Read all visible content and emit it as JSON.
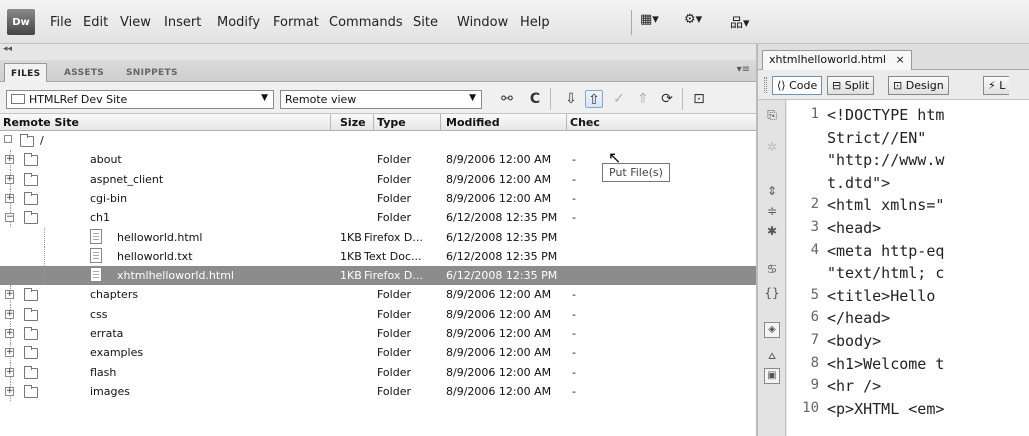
{
  "app": {
    "logo": "Dw"
  },
  "menu": {
    "items": [
      "File",
      "Edit",
      "View",
      "Insert",
      "Modify",
      "Format",
      "Commands",
      "Site",
      "Window",
      "Help"
    ]
  },
  "menu_buttons": [
    {
      "icon": "layout-icon",
      "glyph": "▦▾"
    },
    {
      "icon": "gear-icon",
      "glyph": "⚙▾"
    },
    {
      "icon": "site-map-icon",
      "glyph": "品▾"
    }
  ],
  "panel": {
    "collapse_glyph": "◂◂",
    "tabs": [
      "FILES",
      "ASSETS",
      "SNIPPETS"
    ],
    "active_tab": "FILES",
    "menu_glyph": "▾≡",
    "site_select": "HTMLRef Dev Site",
    "view_select": "Remote view",
    "toolbar_icons": [
      {
        "name": "connect-icon",
        "glyph": "⚯"
      },
      {
        "name": "refresh-icon",
        "glyph": "C"
      },
      {
        "name": "get-file-icon",
        "glyph": "⇩"
      },
      {
        "name": "put-file-icon",
        "glyph": "⇧"
      },
      {
        "name": "check-out-icon",
        "glyph": "✓"
      },
      {
        "name": "check-in-icon",
        "glyph": "⇑"
      },
      {
        "name": "synchronize-icon",
        "glyph": "⟳"
      },
      {
        "name": "expand-icon",
        "glyph": "⊡"
      }
    ],
    "tooltip": "Put File(s)",
    "columns": {
      "name": "Remote Site",
      "size": "Size",
      "type": "Type",
      "modified": "Modified",
      "checked": "Chec"
    },
    "root": "/",
    "files": [
      {
        "name": "about",
        "size": "",
        "type": "Folder",
        "modified": "8/9/2006 12:00 AM",
        "checked": "-",
        "kind": "folder",
        "level": 1,
        "expander": "+"
      },
      {
        "name": "aspnet_client",
        "size": "",
        "type": "Folder",
        "modified": "8/9/2006 12:00 AM",
        "checked": "-",
        "kind": "folder",
        "level": 1,
        "expander": "+"
      },
      {
        "name": "cgi-bin",
        "size": "",
        "type": "Folder",
        "modified": "8/9/2006 12:00 AM",
        "checked": "-",
        "kind": "folder",
        "level": 1,
        "expander": "+"
      },
      {
        "name": "ch1",
        "size": "",
        "type": "Folder",
        "modified": "6/12/2008 12:35 PM",
        "checked": "-",
        "kind": "folder",
        "level": 1,
        "expander": "−"
      },
      {
        "name": "helloworld.html",
        "size": "1KB",
        "type": "Firefox D...",
        "modified": "6/12/2008 12:35 PM",
        "checked": "",
        "kind": "html",
        "level": 2
      },
      {
        "name": "helloworld.txt",
        "size": "1KB",
        "type": "Text Doc...",
        "modified": "6/12/2008 12:35 PM",
        "checked": "",
        "kind": "text",
        "level": 2
      },
      {
        "name": "xhtmlhelloworld.html",
        "size": "1KB",
        "type": "Firefox D...",
        "modified": "6/12/2008 12:35 PM",
        "checked": "",
        "kind": "html",
        "level": 2,
        "selected": true
      },
      {
        "name": "chapters",
        "size": "",
        "type": "Folder",
        "modified": "8/9/2006 12:00 AM",
        "checked": "-",
        "kind": "folder",
        "level": 1,
        "expander": "+"
      },
      {
        "name": "css",
        "size": "",
        "type": "Folder",
        "modified": "8/9/2006 12:00 AM",
        "checked": "-",
        "kind": "folder",
        "level": 1,
        "expander": "+"
      },
      {
        "name": "errata",
        "size": "",
        "type": "Folder",
        "modified": "8/9/2006 12:00 AM",
        "checked": "-",
        "kind": "folder",
        "level": 1,
        "expander": "+"
      },
      {
        "name": "examples",
        "size": "",
        "type": "Folder",
        "modified": "8/9/2006 12:00 AM",
        "checked": "-",
        "kind": "folder",
        "level": 1,
        "expander": "+"
      },
      {
        "name": "flash",
        "size": "",
        "type": "Folder",
        "modified": "8/9/2006 12:00 AM",
        "checked": "-",
        "kind": "folder",
        "level": 1,
        "expander": "+"
      },
      {
        "name": "images",
        "size": "",
        "type": "Folder",
        "modified": "8/9/2006 12:00 AM",
        "checked": "-",
        "kind": "folder",
        "level": 1,
        "expander": "+"
      }
    ]
  },
  "document": {
    "tab_title": "xhtmlhelloworld.html",
    "close_glyph": "×",
    "view_buttons": [
      "Code",
      "Split",
      "Design"
    ],
    "active_view": "Code",
    "truncated_button": "L",
    "gutter_icons": [
      "open-documents-icon",
      "collapse-icon",
      "expand-all-icon",
      "select-parent-icon",
      "balance-braces-icon",
      "line-numbers-icon",
      "highlight-invalid-icon",
      "syntax-coloring-icon",
      "apply-comment-icon",
      "format-source-icon"
    ],
    "lines": [
      {
        "num": "1",
        "text": "<!DOCTYPE htm"
      },
      {
        "num": "",
        "text": "Strict//EN\""
      },
      {
        "num": "",
        "text": "\"http://www.w"
      },
      {
        "num": "",
        "text": "t.dtd\">"
      },
      {
        "num": "2",
        "text": "<html xmlns=\""
      },
      {
        "num": "3",
        "text": "<head>"
      },
      {
        "num": "4",
        "text": "<meta http-eq"
      },
      {
        "num": "",
        "text": "\"text/html; c"
      },
      {
        "num": "5",
        "text": "<title>Hello "
      },
      {
        "num": "6",
        "text": "</head>"
      },
      {
        "num": "7",
        "text": "<body>"
      },
      {
        "num": "8",
        "text": "<h1>Welcome t"
      },
      {
        "num": "9",
        "text": "<hr />"
      },
      {
        "num": "10",
        "text": "<p>XHTML <em>"
      }
    ]
  }
}
